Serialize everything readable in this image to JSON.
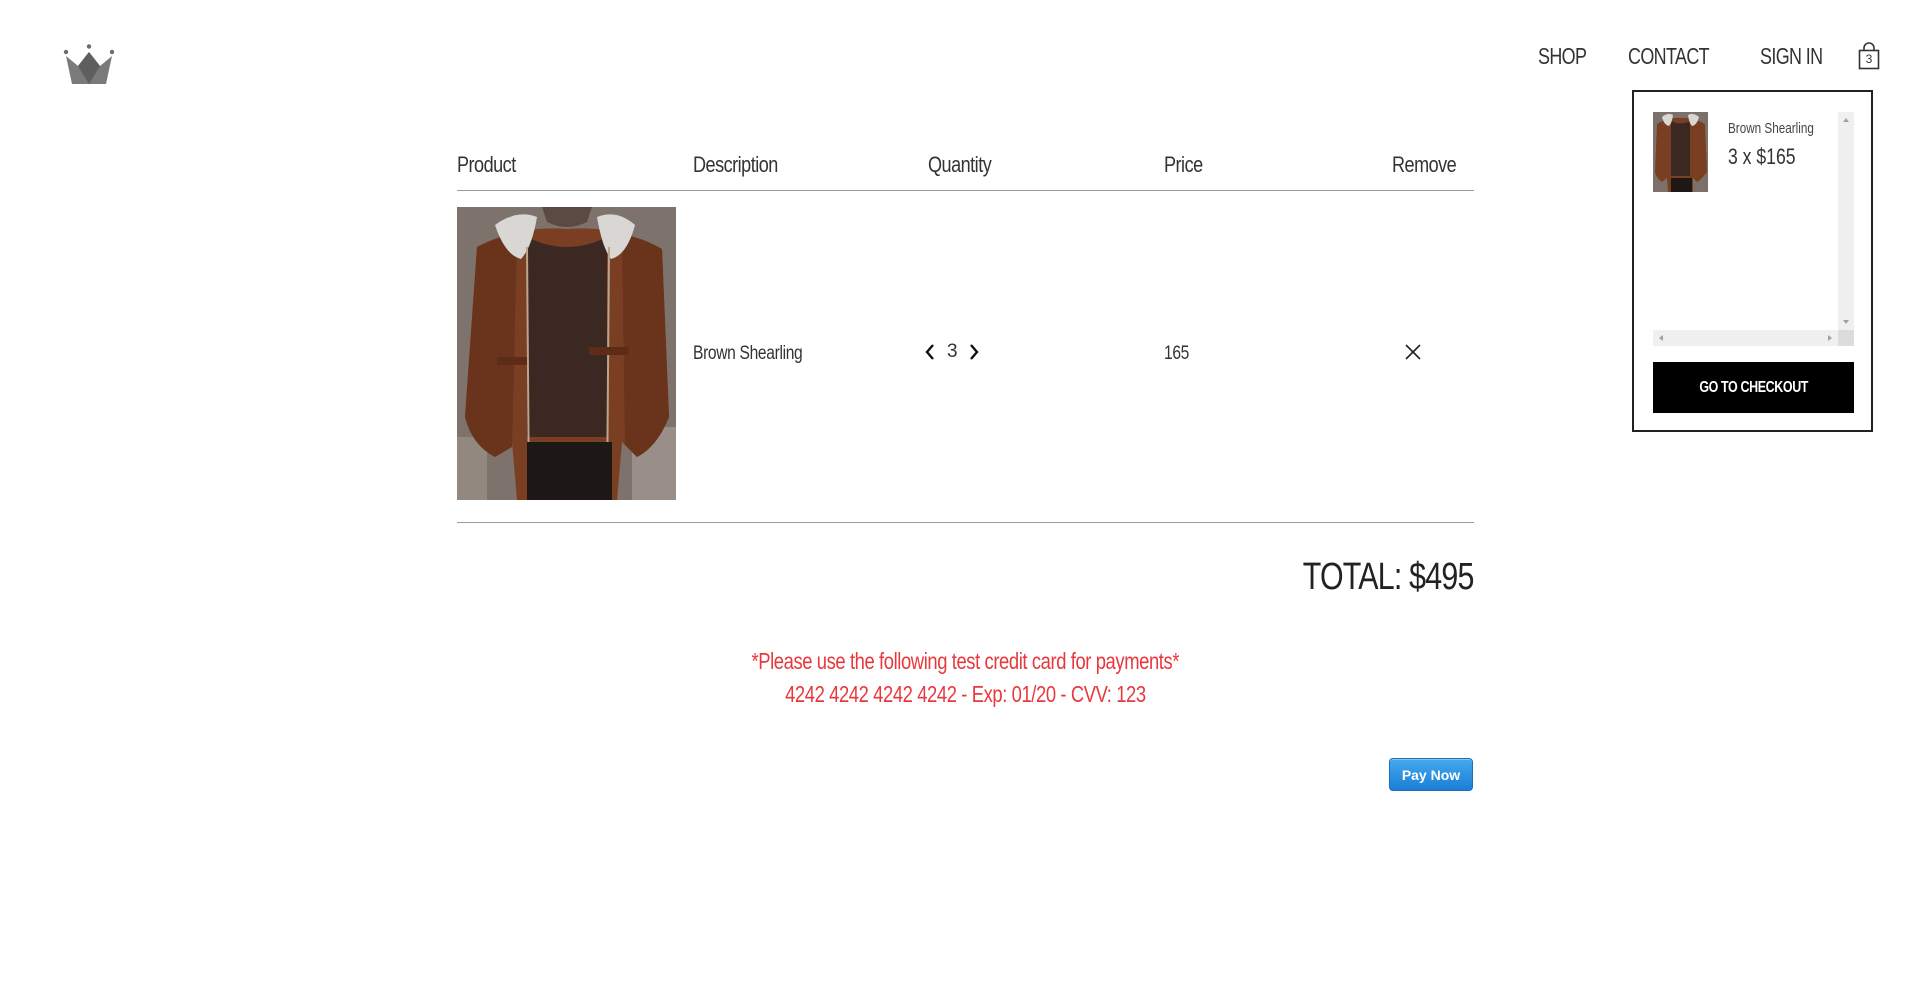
{
  "nav": {
    "shop": "SHOP",
    "contact": "CONTACT",
    "sign_in": "SIGN IN",
    "cart_count": "3"
  },
  "table": {
    "headers": {
      "product": "Product",
      "description": "Description",
      "quantity": "Quantity",
      "price": "Price",
      "remove": "Remove"
    },
    "rows": [
      {
        "description": "Brown Shearling",
        "quantity": "3",
        "price": "165"
      }
    ]
  },
  "total": "TOTAL: $495",
  "notice": {
    "line1": "*Please use the following test credit card for payments*",
    "line2": "4242 4242 4242 4242 - Exp: 01/20 - CVV: 123"
  },
  "pay_button": "Pay Now",
  "mini_cart": {
    "items": [
      {
        "name": "Brown Shearling",
        "qty_price": "3 x $165"
      }
    ],
    "checkout_label": "GO TO CHECKOUT"
  },
  "colors": {
    "notice": "#e8383d",
    "pay_button": "#1a7fd6",
    "checkout_button": "#000000",
    "logo": "#6b6b6b"
  }
}
